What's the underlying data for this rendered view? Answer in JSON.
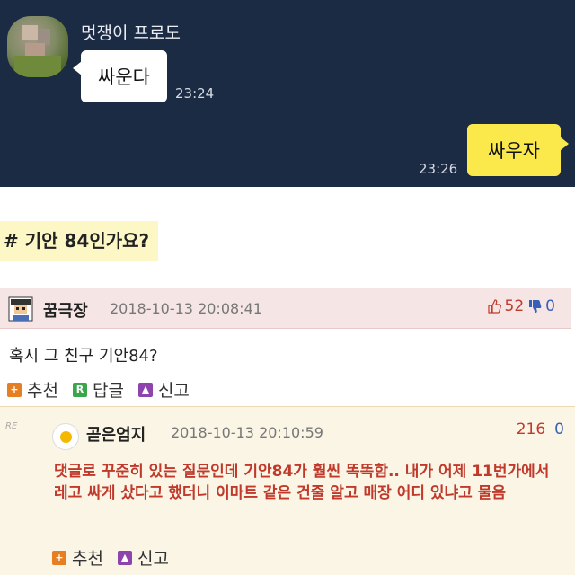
{
  "chat": {
    "sender_name": "멋쟁이 프로도",
    "incoming_message": "싸운다",
    "incoming_time": "23:24",
    "outgoing_message": "싸우자",
    "outgoing_time": "23:26"
  },
  "post": {
    "title": "# 기안 84인가요?"
  },
  "comment": {
    "username": "꿈극장",
    "datetime": "2018-10-13 20:08:41",
    "upvotes": "52",
    "downvotes": "0",
    "text": "혹시 그 친구 기안84?",
    "actions": {
      "recommend": "추천",
      "reply": "답글",
      "report": "신고"
    }
  },
  "reply": {
    "re_label": "RE",
    "username": "곧은엄지",
    "datetime": "2018-10-13 20:10:59",
    "upvotes": "216",
    "downvotes": "0",
    "text": "댓글로 꾸준히 있는 질문인데 기안84가 훨씬 똑똑함.. 내가 어제 11번가에서 레고 싸게 샀다고 했더니 이마트 같은 건줄 알고 매장 어디 있냐고 물음",
    "actions": {
      "recommend": "추천",
      "report": "신고"
    }
  },
  "icons": {
    "recommend": "plus-icon",
    "reply": "reply-icon",
    "report": "siren-icon",
    "thumb_up": "thumb-up-icon",
    "thumb_down": "thumb-down-icon"
  },
  "colors": {
    "chat_background": "#1c2b44",
    "outgoing_bubble": "#fbe94c",
    "reply_text": "#c0392b"
  }
}
